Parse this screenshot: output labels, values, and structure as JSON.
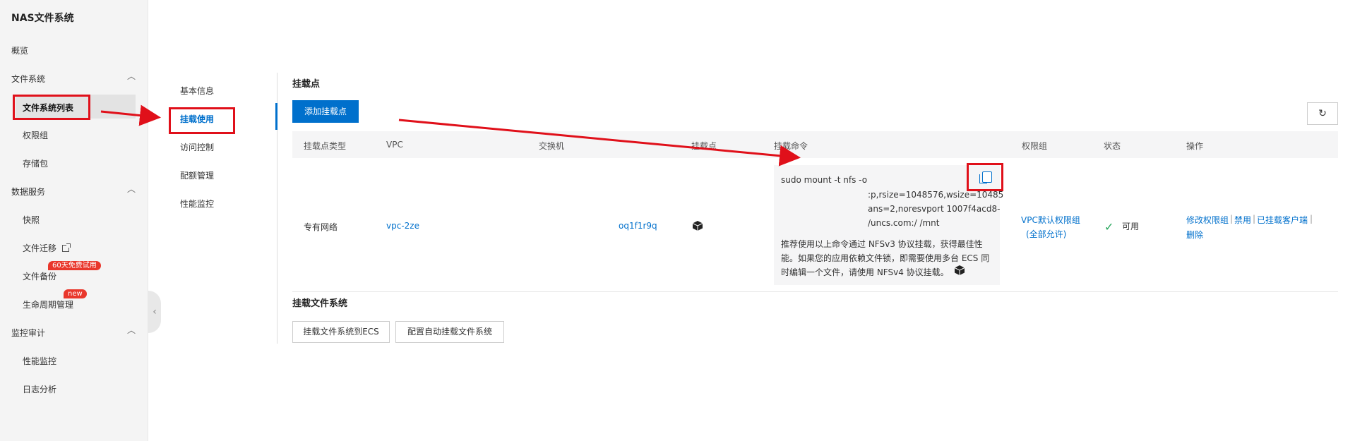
{
  "app": {
    "title": "NAS文件系统"
  },
  "sidebar": {
    "overview": "概览",
    "groups": [
      {
        "label": "文件系统",
        "items": [
          "文件系统列表",
          "权限组",
          "存储包"
        ]
      },
      {
        "label": "数据服务",
        "items": [
          "快照",
          "文件迁移",
          "文件备份",
          "生命周期管理"
        ]
      },
      {
        "label": "监控审计",
        "items": [
          "性能监控",
          "日志分析"
        ]
      }
    ],
    "badges": {
      "backup": "60天免费试用",
      "lifecycle": "new"
    }
  },
  "submenu": [
    "基本信息",
    "挂载使用",
    "访问控制",
    "配额管理",
    "性能监控"
  ],
  "mount_points": {
    "title": "挂载点",
    "add_button": "添加挂载点",
    "columns": [
      "挂载点类型",
      "VPC",
      "交换机",
      "挂载点",
      "挂载命令",
      "权限组",
      "状态",
      "操作"
    ],
    "row": {
      "type": "专有网络",
      "vpc": "vpc-2ze",
      "vswitch": "oq1f1r9q",
      "command_lines": [
        "sudo mount -t nfs -o",
        ":p,rsize=1048576,wsize=10485",
        "ans=2,noresvport 1007f4acd8-",
        "/uncs.com:/ /mnt"
      ],
      "command_note": "推荐使用以上命令通过 NFSv3 协议挂载，获得最佳性能。如果您的应用依赖文件锁，即需要使用多台 ECS 同时编辑一个文件，请使用 NFSv4 协议挂载。",
      "permission_group": "VPC默认权限组",
      "permission_note": "(全部允许)",
      "status": "可用",
      "actions": [
        "修改权限组",
        "禁用",
        "已挂载客户端",
        "删除"
      ]
    }
  },
  "mount_fs": {
    "title": "挂载文件系统",
    "buttons": [
      "挂载文件系统到ECS",
      "配置自动挂载文件系统"
    ]
  },
  "colors": {
    "accent": "#0070cc",
    "annotation": "#e0101a",
    "success": "#26a65b"
  }
}
